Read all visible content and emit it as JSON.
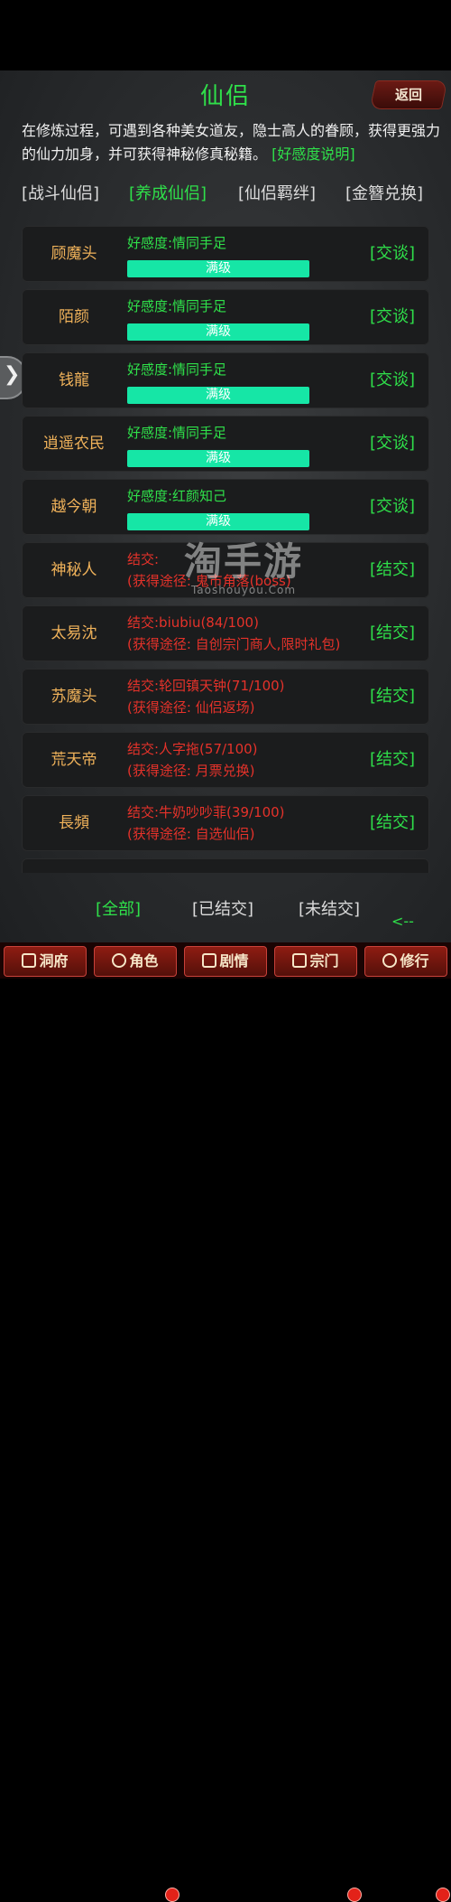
{
  "header": {
    "title": "仙侣",
    "back_label": "返回"
  },
  "intro": {
    "text": "在修炼过程，可遇到各种美女道友，隐士高人的眷顾，获得更强力的仙力加身，并可获得神秘修真秘籍。",
    "link": "[好感度说明]"
  },
  "tabs": [
    {
      "label": "[战斗仙侣]"
    },
    {
      "label": "[养成仙侣]",
      "active": true
    },
    {
      "label": "[仙侣羁绊]"
    },
    {
      "label": "[金簪兑换]"
    }
  ],
  "rows": [
    {
      "name": "顾魔头",
      "line1": "好感度:情同手足",
      "bar": "满级",
      "action": "[交谈]"
    },
    {
      "name": "陌颜",
      "line1": "好感度:情同手足",
      "bar": "满级",
      "action": "[交谈]"
    },
    {
      "name": "钱龍",
      "line1": "好感度:情同手足",
      "bar": "满级",
      "action": "[交谈]"
    },
    {
      "name": "逍遥农民",
      "line1": "好感度:情同手足",
      "bar": "满级",
      "action": "[交谈]"
    },
    {
      "name": "越今朝",
      "line1": "好感度:红颜知己",
      "bar": "满级",
      "action": "[交谈]"
    },
    {
      "name": "神秘人",
      "line1": "结交:",
      "line2": "(获得途径: 鬼市角落(boss)",
      "action": "[结交]"
    },
    {
      "name": "太易沈",
      "line1": "结交:biubiu(84/100)",
      "line2": "(获得途径: 自创宗门商人,限时礼包)",
      "action": "[结交]"
    },
    {
      "name": "苏魔头",
      "line1": "结交:轮回镇天钟(71/100)",
      "line2": "(获得途径: 仙侣返场)",
      "action": "[结交]"
    },
    {
      "name": "荒天帝",
      "line1": "结交:人字拖(57/100)",
      "line2": "(获得途径: 月票兑换)",
      "action": "[结交]"
    },
    {
      "name": "長頻",
      "line1": "结交:牛奶吵吵菲(39/100)",
      "line2": "(获得途径: 自选仙侣)",
      "action": "[结交]"
    }
  ],
  "watermark": {
    "line1": "淘手游",
    "line2": "Taoshouyou.Com"
  },
  "filters": [
    {
      "label": "[全部]",
      "active": true
    },
    {
      "label": "[已结交]"
    },
    {
      "label": "[未结交]"
    }
  ],
  "back_arrow": "<--",
  "bottom_nav": [
    {
      "label": "洞府",
      "icon": "cave-icon"
    },
    {
      "label": "角色",
      "icon": "character-icon",
      "badge": true
    },
    {
      "label": "剧情",
      "icon": "story-icon"
    },
    {
      "label": "宗门",
      "icon": "sect-icon",
      "badge": true
    },
    {
      "label": "修行",
      "icon": "cultivate-icon",
      "badge": true
    }
  ],
  "colors": {
    "accent_green": "#2fe04a",
    "bar_teal": "#16e6a6",
    "name_orange": "#f0b25a",
    "warn_red": "#e5322a",
    "nav_red": "#8e1c12"
  }
}
